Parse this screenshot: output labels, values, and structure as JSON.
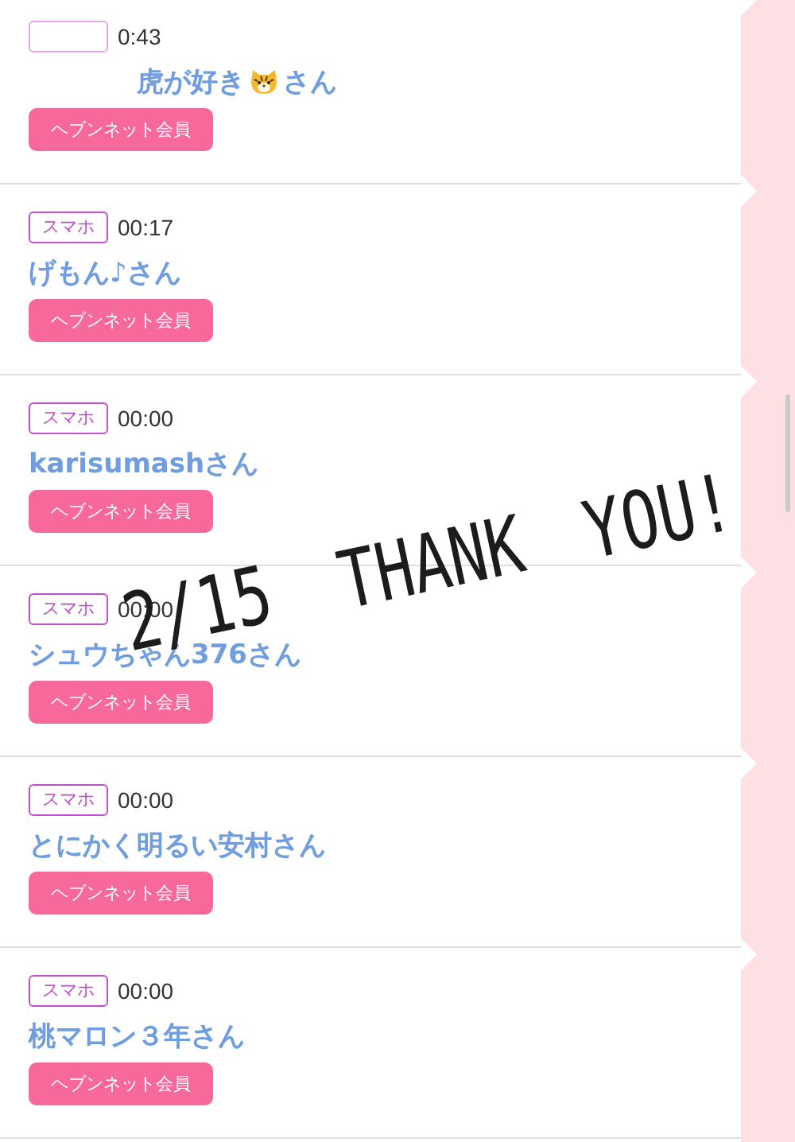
{
  "overlay": {
    "words": [
      "2/15",
      "THANK",
      "YOU!"
    ]
  },
  "entries": [
    {
      "time": "0:43",
      "name": "虎が好き",
      "name_suffix": "さん",
      "member": "ヘブンネット会員"
    },
    {
      "device": "スマホ",
      "time": "00:17",
      "name": "げもん♪さん",
      "member": "ヘブンネット会員"
    },
    {
      "device": "スマホ",
      "time": "00:00",
      "name": "karisumashさん",
      "member": "ヘブンネット会員"
    },
    {
      "device": "スマホ",
      "time": "00:00",
      "name": "シュウちゃん376さん",
      "member": "ヘブンネット会員"
    },
    {
      "device": "スマホ",
      "time": "00:00",
      "name": "とにかく明るい安村さん",
      "member": "ヘブンネット会員"
    },
    {
      "device": "スマホ",
      "time": "00:00",
      "name": "桃マロン３年さん",
      "member": "ヘブンネット会員"
    }
  ]
}
